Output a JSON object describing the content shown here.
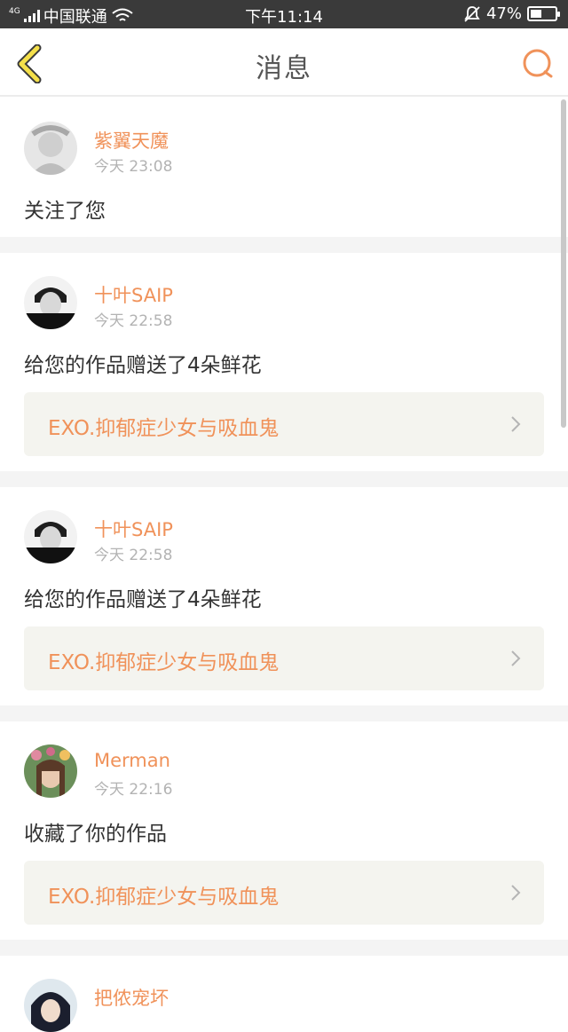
{
  "status_bar": {
    "network_type": "4G",
    "carrier": "中国联通",
    "time": "下午11:14",
    "battery_percent": "47%",
    "battery_level": 0.47
  },
  "header": {
    "title": "消息",
    "back_icon": "chevron-left-icon",
    "search_icon": "search-icon"
  },
  "accent_color": "#f0925a",
  "messages": [
    {
      "username": "紫翼天魔",
      "time": "今天 23:08",
      "action": "关注了您"
    },
    {
      "username": "十叶SAIP",
      "time": "今天 22:58",
      "action": "给您的作品赠送了4朵鲜花",
      "work_title": "EXO.抑郁症少女与吸血鬼"
    },
    {
      "username": "十叶SAIP",
      "time": "今天 22:58",
      "action": "给您的作品赠送了4朵鲜花",
      "work_title": "EXO.抑郁症少女与吸血鬼"
    },
    {
      "username": "Merman",
      "time": "今天 22:16",
      "action": "收藏了你的作品",
      "work_title": "EXO.抑郁症少女与吸血鬼"
    },
    {
      "username": "把侬宠坏"
    }
  ]
}
